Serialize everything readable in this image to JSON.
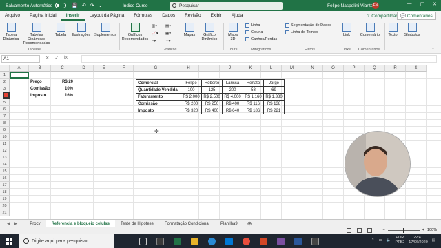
{
  "titlebar": {
    "autosave_label": "Salvamento Automático",
    "doc_title": "Indice Curso  -",
    "search_placeholder": "Pesquisar",
    "user_name": "Felipe Naspolini Viante",
    "user_initials": "FN",
    "win_min": "—",
    "win_max": "▢",
    "win_close": "✕"
  },
  "tabs": [
    "Arquivo",
    "Página Inicial",
    "Inserir",
    "Layout da Página",
    "Fórmulas",
    "Dados",
    "Revisão",
    "Exibir",
    "Ajuda"
  ],
  "share_label": "Compartilhar",
  "comments_label": "Comentários",
  "ribbon": {
    "tabela_dinamica": "Tabela Dinâmica",
    "tabelas_recomendadas": "Tabelas Dinâmicas Recomendadas",
    "tabela": "Tabela",
    "ilustracoes": "Ilustrações",
    "suplementos": "Suplementos",
    "graficos_recomendados": "Gráficos Recomendados",
    "mapas": "Mapas",
    "grafico_dinamico": "Gráfico Dinâmico",
    "mapa3d": "Mapa 3D",
    "linha": "Linha",
    "coluna": "Coluna",
    "ganhos_perdas": "Ganhos/Perdas",
    "segmentacao": "Segmentação de Dados",
    "linha_tempo": "Linha do Tempo",
    "link": "Link",
    "comentario": "Comentário",
    "texto": "Texto",
    "simbolos": "Símbolos",
    "groups": {
      "tabelas": "Tabelas",
      "graficos": "Gráficos",
      "tours": "Tours",
      "minigraficos": "Minigráficos",
      "filtros": "Filtros",
      "links": "Links",
      "comentarios": "Comentários"
    }
  },
  "formula_bar": {
    "name_box": "A1",
    "fx": "fx"
  },
  "columns": [
    "A",
    "B",
    "C",
    "D",
    "E",
    "F",
    "G",
    "H",
    "I",
    "J",
    "K",
    "L",
    "M",
    "N",
    "O",
    "P",
    "Q",
    "R",
    "S"
  ],
  "rows": [
    "1",
    "2",
    "3",
    "4",
    "5",
    "6",
    "7",
    "8",
    "9",
    "10",
    "11",
    "12",
    "13",
    "14",
    "15",
    "16",
    "17",
    "18",
    "19",
    "20",
    "21"
  ],
  "params": [
    {
      "label": "Preço",
      "value": "R$ 20"
    },
    {
      "label": "Comissão",
      "value": "10%"
    },
    {
      "label": "Imposto",
      "value": "16%"
    }
  ],
  "table": {
    "header": [
      "Comercial",
      "Felipe",
      "Roberto",
      "Larissa",
      "Renato",
      "Jorge"
    ],
    "rows": [
      [
        "Quantidade Vendida",
        "100",
        "125",
        "200",
        "58",
        "69"
      ],
      [
        "Faturamento",
        "R$ 2.000",
        "R$ 2.500",
        "R$ 4.000",
        "R$ 1.160",
        "R$ 1.380"
      ],
      [
        "Comissão",
        "R$ 200",
        "R$ 250",
        "R$ 400",
        "R$ 116",
        "R$ 138"
      ],
      [
        "Imposto",
        "R$ 320",
        "R$ 400",
        "R$ 640",
        "R$ 186",
        "R$ 221"
      ]
    ]
  },
  "sheets": {
    "active": "Referencia e bloqueio celulas",
    "list": [
      "Procv",
      "Referencia e bloqueio celulas",
      "Teste de Hipótese",
      "Formatação Condicional",
      "Planilha9"
    ],
    "add": "⊕"
  },
  "status": {
    "zoom_minus": "−",
    "zoom_plus": "+",
    "zoom": "100%"
  },
  "taskbar": {
    "search_placeholder": "Digite aqui para pesquisar",
    "lang": "POR",
    "layout": "PTB2",
    "time": "22:41",
    "date": "17/06/2020"
  }
}
